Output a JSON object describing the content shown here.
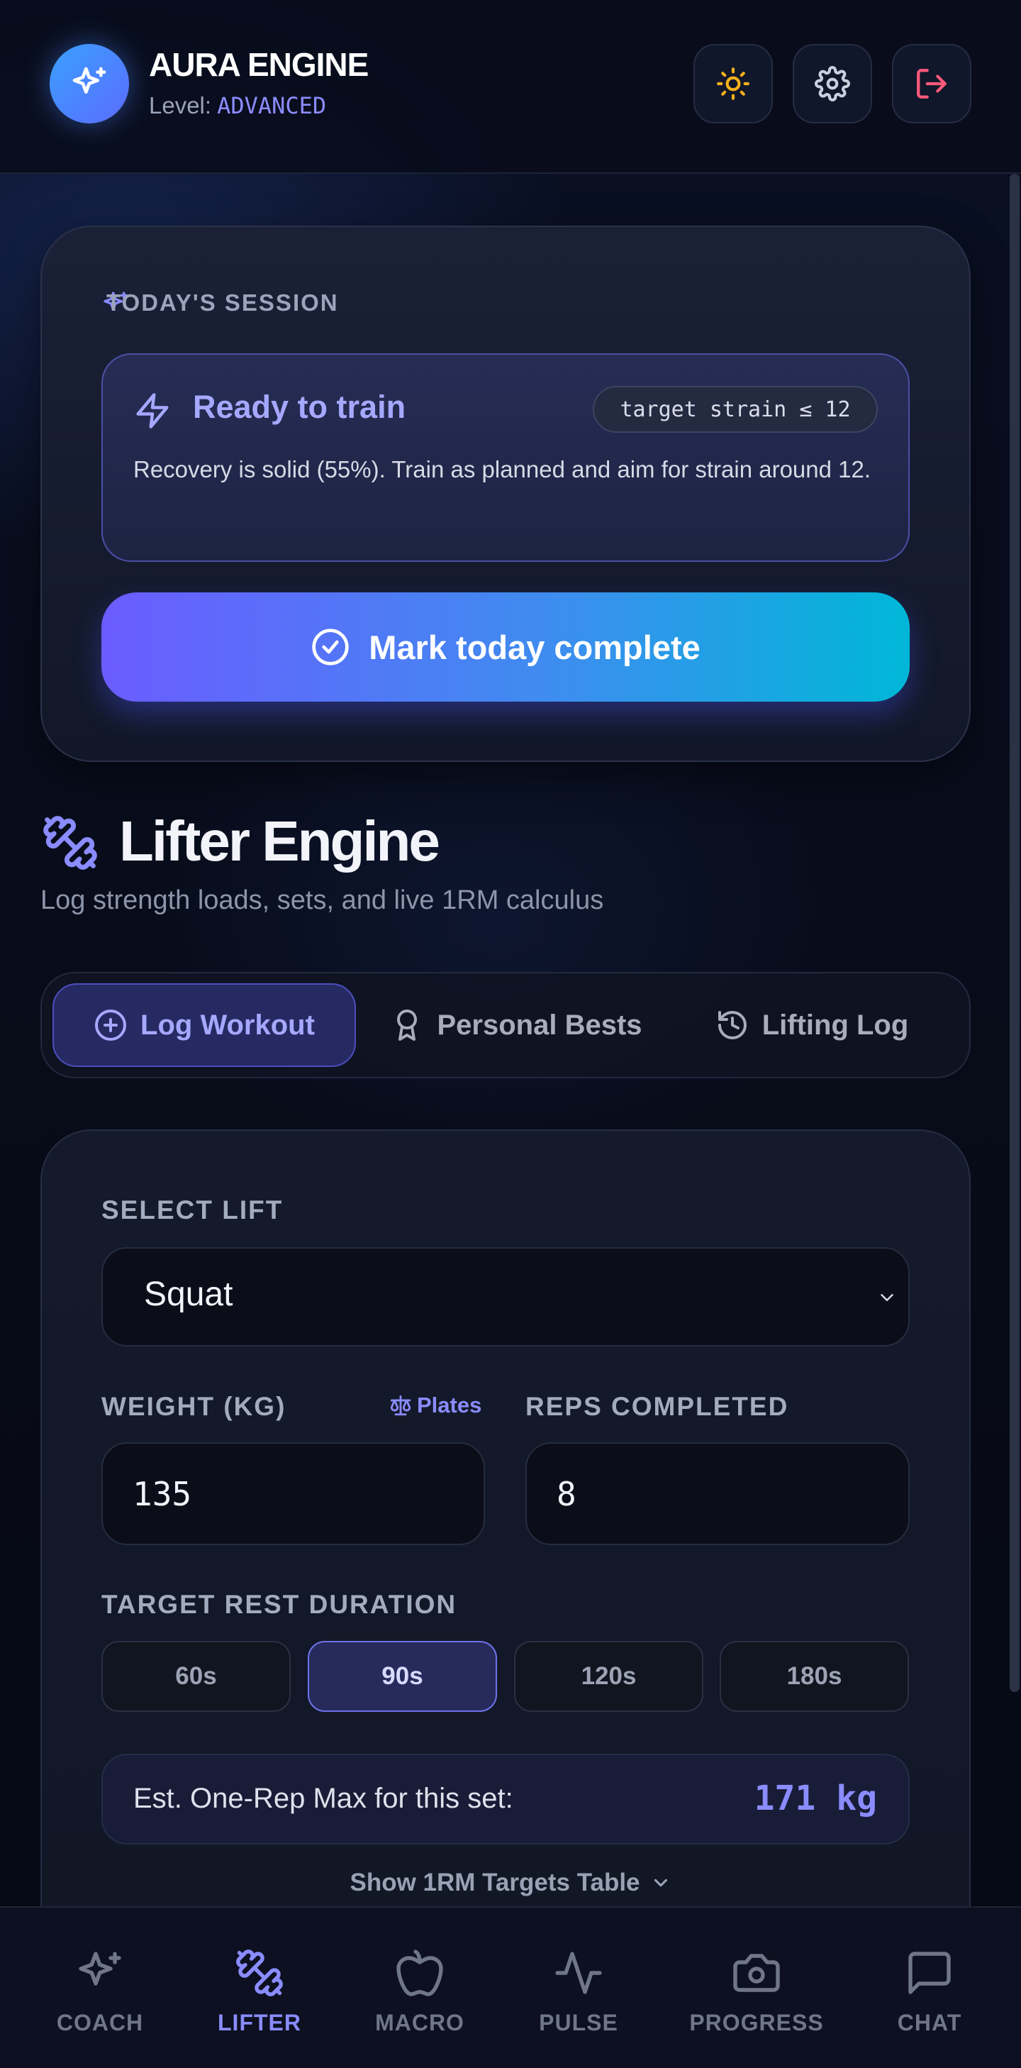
{
  "header": {
    "app_title": "AURA ENGINE",
    "level_label": "Level:",
    "level_value": "ADVANCED",
    "icons": [
      "sparkles-icon",
      "sun-icon",
      "gear-icon",
      "logout-icon"
    ]
  },
  "session": {
    "label": "TODAY'S SESSION",
    "status_title": "Ready to train",
    "strain_badge": "target strain ≤ 12",
    "message": "Recovery is solid (55%). Train as planned and aim for strain around 12.",
    "complete_button": "Mark today complete"
  },
  "lifter": {
    "title": "Lifter Engine",
    "subtitle": "Log strength loads, sets, and live 1RM calculus",
    "tabs": [
      {
        "label": "Log Workout",
        "active": true
      },
      {
        "label": "Personal Bests",
        "active": false
      },
      {
        "label": "Lifting Log",
        "active": false
      }
    ]
  },
  "form": {
    "select_lift_label": "SELECT LIFT",
    "selected_lift": "Squat",
    "weight_label": "WEIGHT (KG)",
    "plates_link": "Plates",
    "weight_value": "135",
    "reps_label": "REPS COMPLETED",
    "reps_value": "8",
    "rest_label": "TARGET REST DURATION",
    "rest_options": [
      {
        "label": "60s",
        "active": false
      },
      {
        "label": "90s",
        "active": true
      },
      {
        "label": "120s",
        "active": false
      },
      {
        "label": "180s",
        "active": false
      }
    ],
    "orm_label": "Est. One-Rep Max for this set:",
    "orm_value": "171 kg",
    "show_table": "Show 1RM Targets Table"
  },
  "nav": {
    "items": [
      {
        "label": "COACH",
        "active": false
      },
      {
        "label": "LIFTER",
        "active": true
      },
      {
        "label": "MACRO",
        "active": false
      },
      {
        "label": "PULSE",
        "active": false
      },
      {
        "label": "PROGRESS",
        "active": false
      },
      {
        "label": "CHAT",
        "active": false
      }
    ]
  },
  "colors": {
    "accent": "#8a8cff",
    "gradient_start": "#6b5cff",
    "gradient_end": "#00b7d8",
    "background": "#070b17",
    "logout": "#ff5a7a",
    "sun": "#f5b21c"
  }
}
